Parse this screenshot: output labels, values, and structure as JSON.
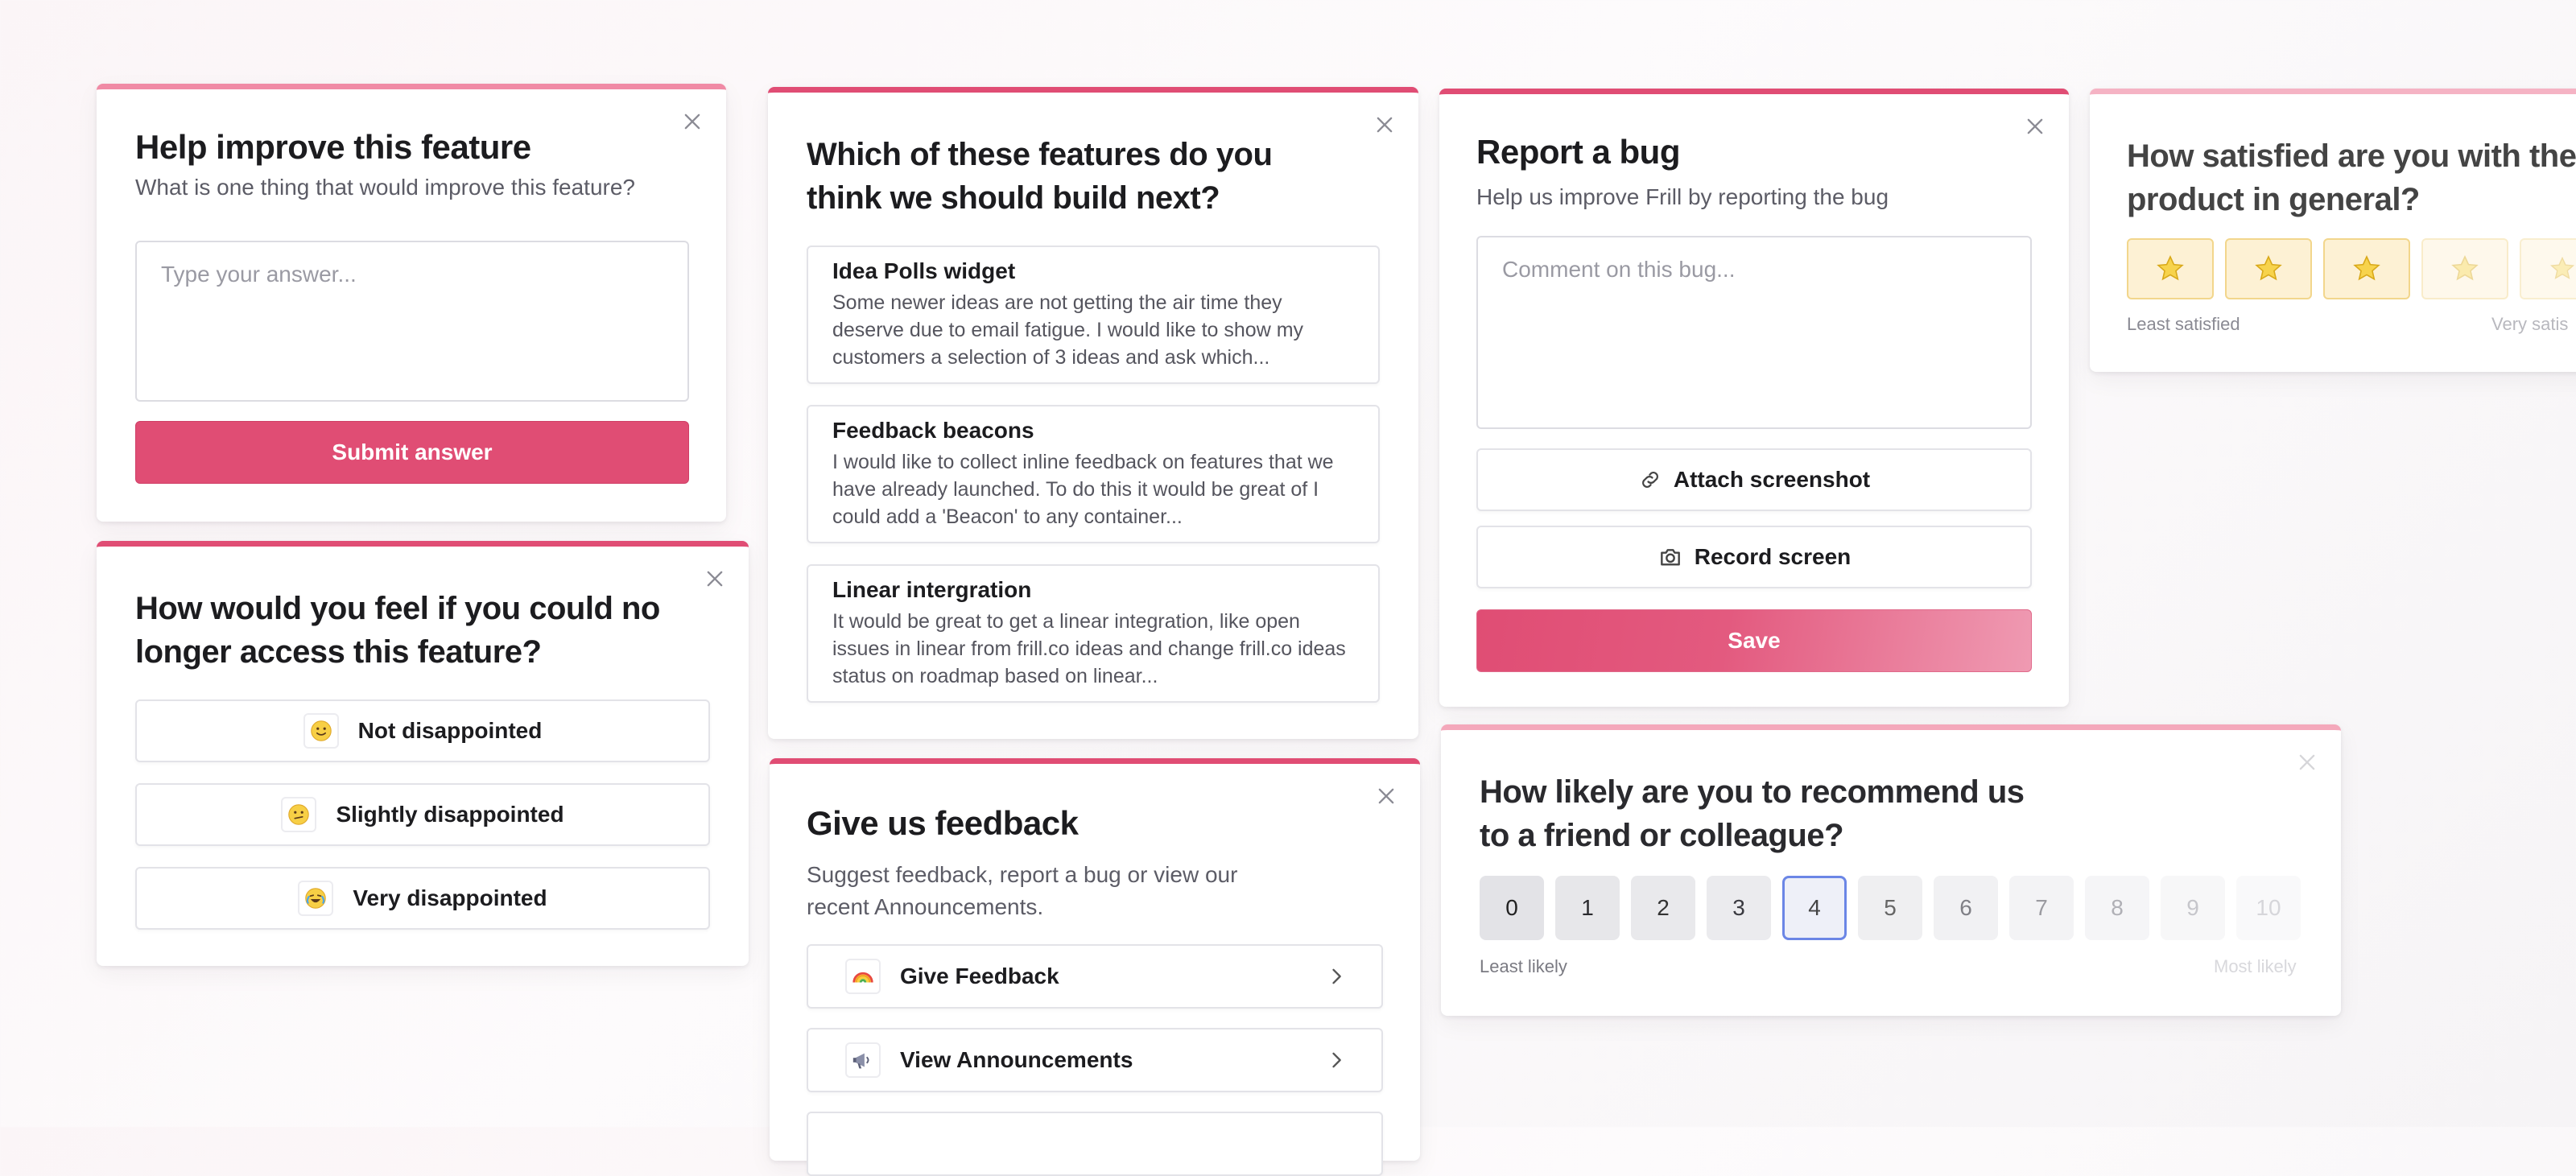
{
  "colors": {
    "accent": "#e04d74",
    "star_fill": "#f7d34c",
    "selected_border": "#6b86e6"
  },
  "improve": {
    "title": "Help improve this feature",
    "subtitle": "What is one thing that would improve this feature?",
    "placeholder": "Type your answer...",
    "submit_label": "Submit answer"
  },
  "pmf": {
    "title": "How would you feel if you could no longer access this feature?",
    "options": [
      {
        "emoji": "slightly-smiling-face-icon",
        "label": "Not disappointed"
      },
      {
        "emoji": "confused-face-icon",
        "label": "Slightly disappointed"
      },
      {
        "emoji": "crying-laughing-face-icon",
        "label": "Very disappointed"
      }
    ]
  },
  "features": {
    "title": "Which of these features do you think we should build next?",
    "items": [
      {
        "title": "Idea Polls widget",
        "desc": "Some newer ideas are not getting the air time they deserve due to email fatigue. I would like to show my customers a selection of 3 ideas and ask which..."
      },
      {
        "title": "Feedback beacons",
        "desc": "I would like to collect inline feedback on features that we have already launched. To do this it would be great of I could add a 'Beacon' to any container..."
      },
      {
        "title": "Linear intergration",
        "desc": "It would be great to get a linear integration, like open issues in linear from frill.co ideas and change frill.co ideas status on roadmap based on linear..."
      }
    ]
  },
  "feedback": {
    "title": "Give us feedback",
    "subtitle": "Suggest feedback, report a bug or view our recent Announcements.",
    "links": [
      {
        "icon": "rainbow-icon",
        "label": "Give Feedback"
      },
      {
        "icon": "megaphone-icon",
        "label": "View Announcements"
      }
    ]
  },
  "bug": {
    "title": "Report a bug",
    "subtitle": "Help us improve Frill by reporting the bug",
    "placeholder": "Comment on this bug...",
    "attach_label": "Attach screenshot",
    "record_label": "Record screen",
    "save_label": "Save"
  },
  "nps": {
    "title": "How likely are you to recommend us to a friend or colleague?",
    "scale": [
      "0",
      "1",
      "2",
      "3",
      "4",
      "5",
      "6",
      "7",
      "8",
      "9",
      "10"
    ],
    "selected": "4",
    "low_label": "Least likely",
    "high_label": "Most likely"
  },
  "csat": {
    "title": "How satisfied are you with the product in general?",
    "star_count_visible": 5,
    "low_label": "Least satisfied",
    "high_label": "Very satis"
  }
}
